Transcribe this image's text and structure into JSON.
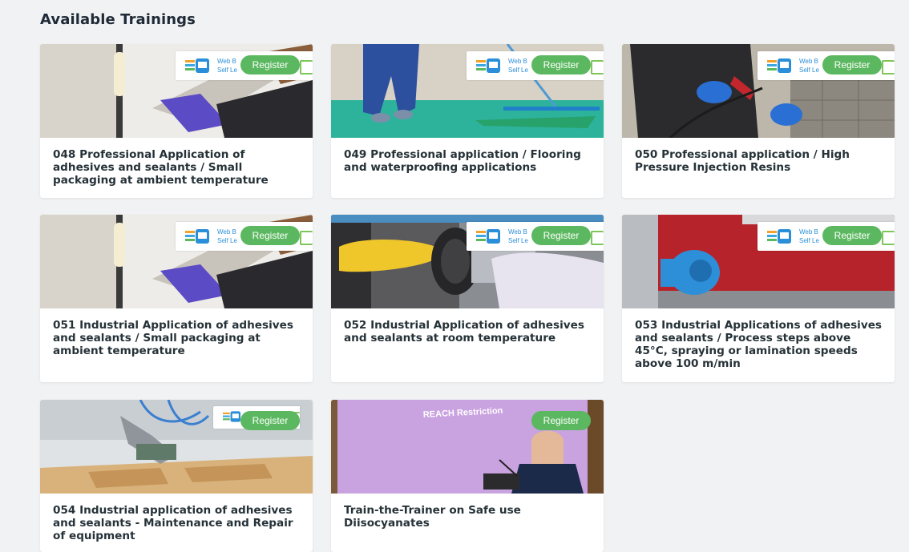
{
  "page": {
    "title": "Available Trainings"
  },
  "badge": {
    "text_line1": "Web B",
    "text_line2": "Self Le",
    "register_label": "Register"
  },
  "cards": [
    {
      "title": "048 Professional Application of adhesives and sealants / Small packaging at ambient temperature"
    },
    {
      "title": "049 Professional application / Flooring and waterproofing applications"
    },
    {
      "title": "050 Professional application / High Pressure Injection Resins"
    },
    {
      "title": "051 Industrial Application of adhesives and sealants / Small packaging at ambient temperature"
    },
    {
      "title": "052 Industrial Application of adhesives and sealants at room temperature"
    },
    {
      "title": "053 Industrial Applications of adhesives and sealants / Process steps above 45°C, spraying or lamination speeds above 100 m/min"
    },
    {
      "title": "054 Industrial application of adhesives and sealants - Maintenance and Repair of equipment"
    },
    {
      "title": "Train-the-Trainer on Safe use Diisocyanates",
      "image_text": "REACH Restriction"
    }
  ],
  "colors": {
    "register_green": "#5cb860",
    "title_text": "#263238",
    "page_bg": "#f1f2f4"
  }
}
